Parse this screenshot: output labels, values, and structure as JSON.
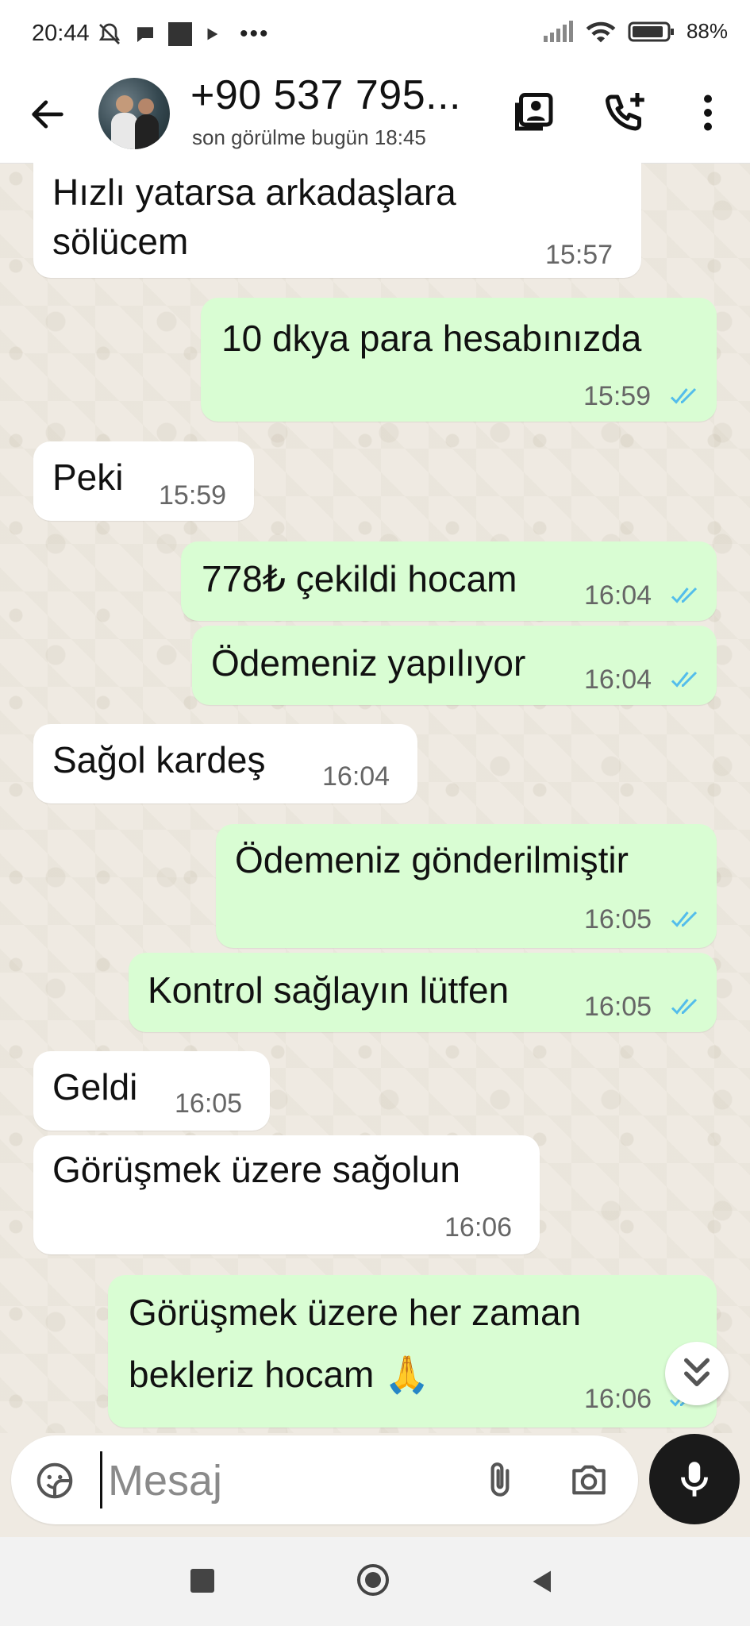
{
  "status_bar": {
    "time": "20:44",
    "battery": "88%",
    "icons": [
      "mute-bell-icon",
      "chat-bubble-icon",
      "square-icon",
      "play-icon",
      "more-dots-icon",
      "signal-icon",
      "wifi-icon",
      "battery-icon"
    ]
  },
  "header": {
    "contact_name": "+90 537 795...",
    "last_seen": "son görülme bugün 18:45",
    "icons": [
      "back-arrow-icon",
      "contact-card-icon",
      "add-call-icon",
      "overflow-menu-icon"
    ]
  },
  "messages": [
    {
      "direction": "in",
      "lines": [
        "Hızlı yatarsa arkadaşlara",
        "sölücem"
      ],
      "time": "15:57"
    },
    {
      "direction": "out",
      "lines": [
        "10 dkya para hesabınızda"
      ],
      "time": "15:59",
      "read": true
    },
    {
      "direction": "in",
      "lines": [
        "Peki"
      ],
      "time": "15:59"
    },
    {
      "direction": "out",
      "lines": [
        "778₺ çekildi hocam"
      ],
      "time": "16:04",
      "read": true
    },
    {
      "direction": "out",
      "lines": [
        "Ödemeniz yapılıyor"
      ],
      "time": "16:04",
      "read": true
    },
    {
      "direction": "in",
      "lines": [
        "Sağol kardeş"
      ],
      "time": "16:04"
    },
    {
      "direction": "out",
      "lines": [
        "Ödemeniz gönderilmiştir"
      ],
      "time": "16:05",
      "read": true
    },
    {
      "direction": "out",
      "lines": [
        "Kontrol sağlayın lütfen"
      ],
      "time": "16:05",
      "read": true
    },
    {
      "direction": "in",
      "lines": [
        "Geldi"
      ],
      "time": "16:05"
    },
    {
      "direction": "in",
      "lines": [
        "Görüşmek üzere sağolun"
      ],
      "time": "16:06"
    },
    {
      "direction": "out",
      "lines": [
        "Görüşmek üzere her zaman",
        "bekleriz hocam 🙏"
      ],
      "time": "16:06",
      "read": true
    }
  ],
  "composer": {
    "placeholder": "Mesaj",
    "icons": [
      "sticker-icon",
      "attach-icon",
      "camera-icon",
      "mic-icon"
    ]
  },
  "colors": {
    "incoming_bubble": "#ffffff",
    "outgoing_bubble": "#d9fdd3",
    "read_tick": "#53bdeb",
    "wallpaper": "#efeae2"
  }
}
